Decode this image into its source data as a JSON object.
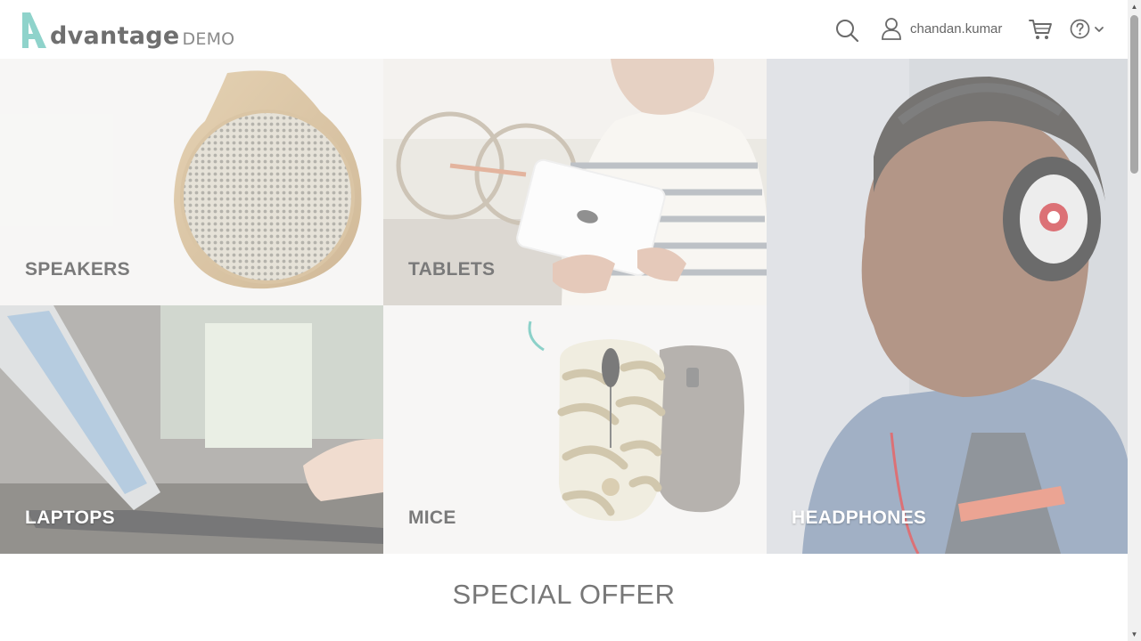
{
  "header": {
    "logo_word": "dvantage",
    "logo_demo": "DEMO",
    "username": "chandan.kumar"
  },
  "categories": [
    {
      "label": "SPEAKERS"
    },
    {
      "label": "TABLETS"
    },
    {
      "label": "HEADPHONES"
    },
    {
      "label": "LAPTOPS"
    },
    {
      "label": "MICE"
    }
  ],
  "special_offer": {
    "title": "SPECIAL OFFER"
  },
  "icons": {
    "search": "search-icon",
    "user": "user-icon",
    "cart": "cart-icon",
    "help": "help-icon",
    "chevron": "chevron-down-icon"
  },
  "colors": {
    "brand_accent": "#8fd3cb",
    "text_gray": "#777777"
  }
}
